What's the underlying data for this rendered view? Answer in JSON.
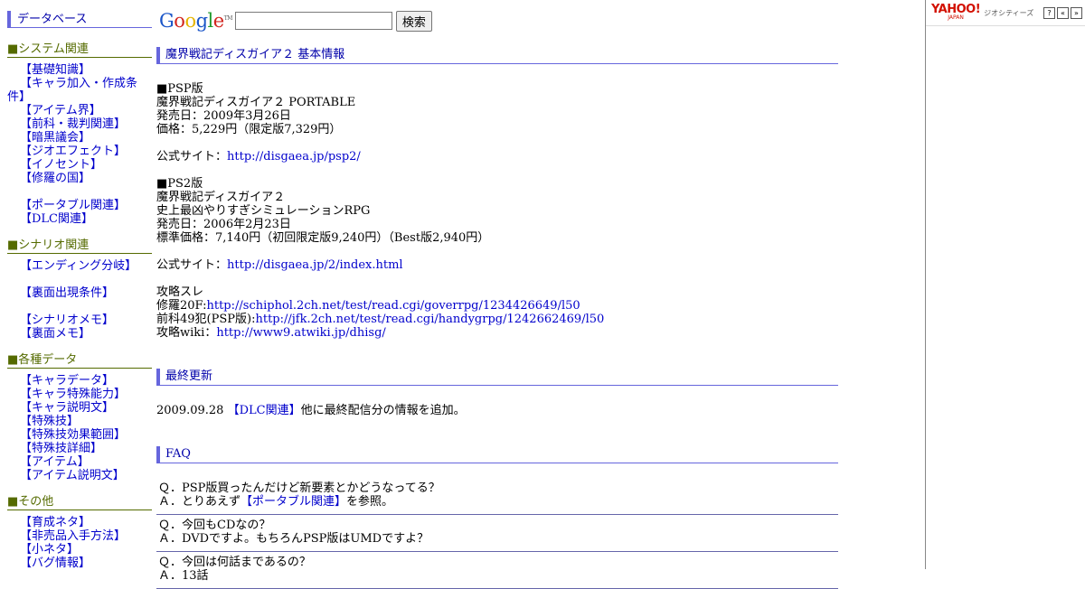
{
  "sidebar": {
    "title": "データベース",
    "sections": [
      {
        "heading": "■システム関連",
        "links": [
          "【基礎知識】",
          "【キャラ加入・作成条件】",
          "【アイテム界】",
          "【前科・裁判関連】",
          "【暗黒議会】",
          "【ジオエフェクト】",
          "【イノセント】",
          "【修羅の国】"
        ],
        "links2": [
          "【ポータブル関連】",
          "【DLC関連】"
        ]
      },
      {
        "heading": "■シナリオ関連",
        "links": [
          "【エンディング分岐】"
        ],
        "links2": [
          "【裏面出現条件】"
        ],
        "links3": [
          "【シナリオメモ】",
          "【裏面メモ】"
        ]
      },
      {
        "heading": "■各種データ",
        "links": [
          "【キャラデータ】",
          "【キャラ特殊能力】",
          "【キャラ説明文】",
          "【特殊技】",
          "【特殊技効果範囲】",
          "【特殊技詳細】",
          "【アイテム】",
          "【アイテム説明文】"
        ]
      },
      {
        "heading": "■その他",
        "links": [
          "【育成ネタ】",
          "【非売品入手方法】",
          "【小ネタ】",
          "【バグ情報】"
        ]
      }
    ]
  },
  "search": {
    "logo": "Google",
    "logo_tm": "TM",
    "input_value": "",
    "button_label": "検索"
  },
  "main": {
    "info_heading": "魔界戦記ディスガイア２ 基本情報",
    "psp": {
      "label": "■PSP版",
      "title": "魔界戦記ディスガイア２ PORTABLE",
      "release": "発売日：2009年3月26日",
      "price": "価格：5,229円（限定版7,329円）",
      "site_label": "公式サイト：",
      "site_url": "http://disgaea.jp/psp2/"
    },
    "ps2": {
      "label": "■PS2版",
      "title": "魔界戦記ディスガイア２",
      "subtitle": "史上最凶やりすぎシミュレーションRPG",
      "release": "発売日：2006年2月23日",
      "price": "標準価格：7,140円（初回限定版9,240円）（Best版2,940円）",
      "site_label": "公式サイト：",
      "site_url": "http://disgaea.jp/2/index.html"
    },
    "threads": {
      "label": "攻略スレ",
      "items": [
        {
          "prefix": "修羅20F:",
          "url": "http://schiphol.2ch.net/test/read.cgi/goverrpg/1234426649/l50"
        },
        {
          "prefix": "前科49犯(PSP版):",
          "url": "http://jfk.2ch.net/test/read.cgi/handygrpg/1242662469/l50"
        },
        {
          "prefix": "攻略wiki：",
          "url": "http://www9.atwiki.jp/dhisg/"
        }
      ]
    },
    "update_heading": "最終更新",
    "update": {
      "date": "2009.09.28 ",
      "link": "【DLC関連】",
      "text": "他に最終配信分の情報を追加。"
    },
    "faq_heading": "FAQ",
    "faq": [
      {
        "q": "Ｑ．PSP版買ったんだけど新要素とかどうなってる？",
        "a_pre": "Ａ．とりあえず",
        "a_link": "【ポータブル関連】",
        "a_post": "を参照。"
      },
      {
        "q": "Ｑ．今回もCDなの？",
        "a_pre": "Ａ．DVDですよ。もちろんPSP版はUMDですよ？",
        "a_link": "",
        "a_post": ""
      },
      {
        "q": "Ｑ．今回は何話まであるの？",
        "a_pre": "Ａ．13話",
        "a_link": "",
        "a_post": ""
      }
    ]
  },
  "ad": {
    "logo": "YAHOO!",
    "logo_sub": "JAPAN",
    "service": "ジオシティーズ",
    "buttons": [
      "?",
      "«",
      "»"
    ]
  }
}
